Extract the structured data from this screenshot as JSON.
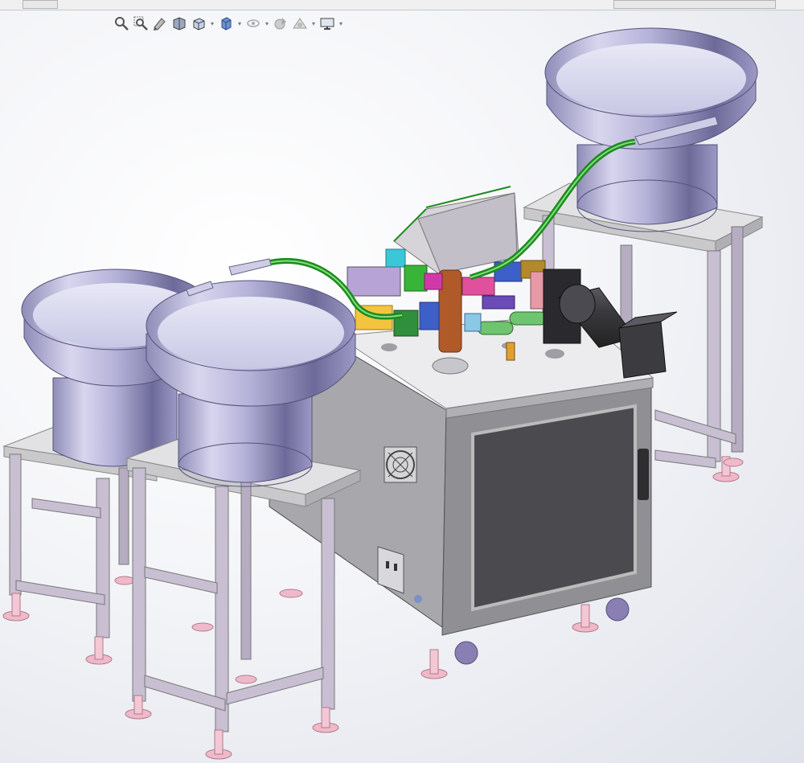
{
  "hud": {
    "buttons": [
      {
        "name": "zoom-to-fit-icon"
      },
      {
        "name": "zoom-to-area-icon"
      },
      {
        "name": "previous-view-icon"
      },
      {
        "name": "section-view-icon"
      },
      {
        "name": "view-orientation-icon",
        "dropdown": true
      },
      {
        "name": "display-style-icon",
        "dropdown": true
      },
      {
        "name": "hide-show-items-icon",
        "dropdown": true
      },
      {
        "name": "edit-appearance-icon"
      },
      {
        "name": "apply-scene-icon",
        "dropdown": true
      },
      {
        "name": "view-settings-icon",
        "dropdown": true
      }
    ]
  },
  "colors": {
    "bowl": "#a9a6cf",
    "frame": "#c8bfd2",
    "cabinet": "#9a9a9e",
    "foot": "#f0b9c9",
    "hose": "#1f8a1f"
  }
}
